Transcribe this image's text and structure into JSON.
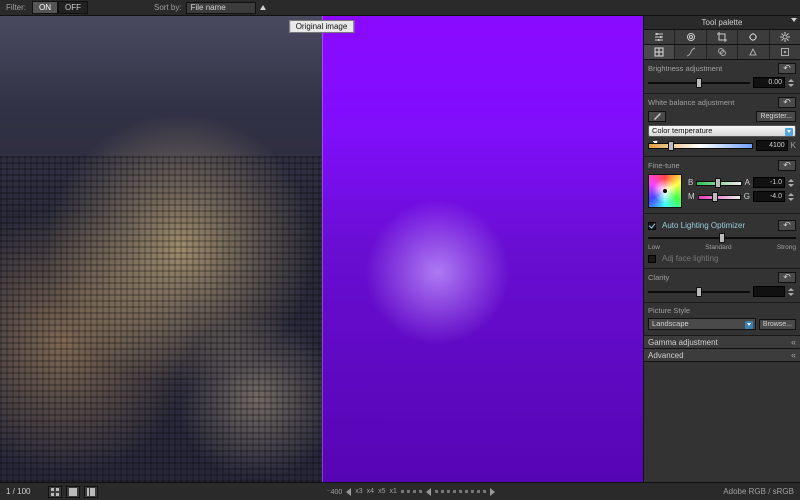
{
  "topbar": {
    "filter_label": "Filter:",
    "on_label": "ON",
    "off_label": "OFF",
    "sortby_label": "Sort by:",
    "sortby_value": "File name"
  },
  "viewer": {
    "overlay_label": "Original image"
  },
  "palette": {
    "title": "Tool palette",
    "brightness": {
      "label": "Brightness adjustment",
      "value": "0.00"
    },
    "white_balance": {
      "label": "White balance adjustment",
      "register_label": "Register...",
      "mode": "Color temperature",
      "temp_value": "4100",
      "temp_unit": "K"
    },
    "fine_tune": {
      "label": "Fine-tune",
      "b_label": "B",
      "a_label": "A",
      "a_value": "-1.0",
      "m_label": "M",
      "g_label": "G",
      "g_value": "-4.0"
    },
    "alo": {
      "label": "Auto Lighting Optimizer",
      "low": "Low",
      "standard": "Standard",
      "strong": "Strong",
      "face_label": "Adj face lighting"
    },
    "clarity": {
      "label": "Clarity"
    },
    "picture_style": {
      "label": "Picture Style",
      "value": "Landscape",
      "browse_label": "Browse..."
    },
    "gamma": {
      "label": "Gamma adjustment"
    },
    "advanced": {
      "label": "Advanced"
    }
  },
  "bottombar": {
    "counter": "1 / 100",
    "zoom400": "400",
    "zoom_x1": "x1",
    "zoom_x3": "x3",
    "zoom_x4": "x4",
    "zoom_x5": "x5",
    "colorspace": "Adobe RGB / sRGB"
  }
}
